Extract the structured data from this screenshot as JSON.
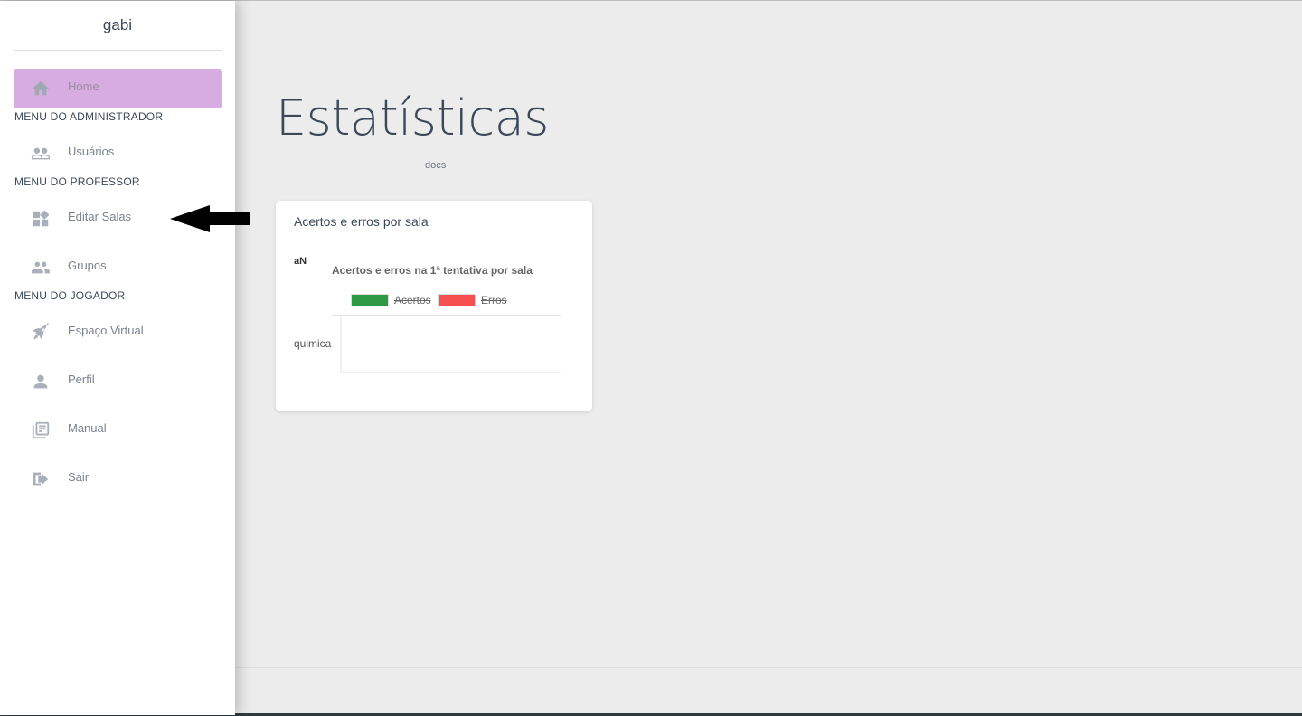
{
  "sidebar": {
    "brand": "gabi",
    "items": {
      "home": {
        "label": "Home",
        "icon": "home-icon"
      },
      "usuarios": {
        "label": "Usuários",
        "icon": "people-icon"
      },
      "editar_salas": {
        "label": "Editar Salas",
        "icon": "dashboard-widgets-icon"
      },
      "grupos": {
        "label": "Grupos",
        "icon": "group-icon"
      },
      "espaco_virtual": {
        "label": "Espaço Virtual",
        "icon": "rocket-icon"
      },
      "perfil": {
        "label": "Perfil",
        "icon": "person-icon"
      },
      "manual": {
        "label": "Manual",
        "icon": "library-books-icon"
      },
      "sair": {
        "label": "Sair",
        "icon": "exit-icon"
      }
    },
    "sections": {
      "admin": "MENU DO ADMINISTRADOR",
      "professor": "MENU DO PROFESSOR",
      "jogador": "MENU DO JOGADOR"
    },
    "active_color": "#d7ace0"
  },
  "main": {
    "title": "Estatísticas",
    "docs_link": "docs",
    "card": {
      "title": "Acertos e erros por sala",
      "nan_label": "aN"
    }
  },
  "chart_data": {
    "type": "bar",
    "orientation": "horizontal",
    "title": "Acertos e erros na 1ª tentativa por sala",
    "categories": [
      "quimica"
    ],
    "series": [
      {
        "name": "Acertos",
        "color": "#2e9a46",
        "hidden": true,
        "values": [
          null
        ]
      },
      {
        "name": "Erros",
        "color": "#f5504f",
        "hidden": true,
        "values": [
          null
        ]
      }
    ],
    "legend": "top",
    "grid": false
  }
}
